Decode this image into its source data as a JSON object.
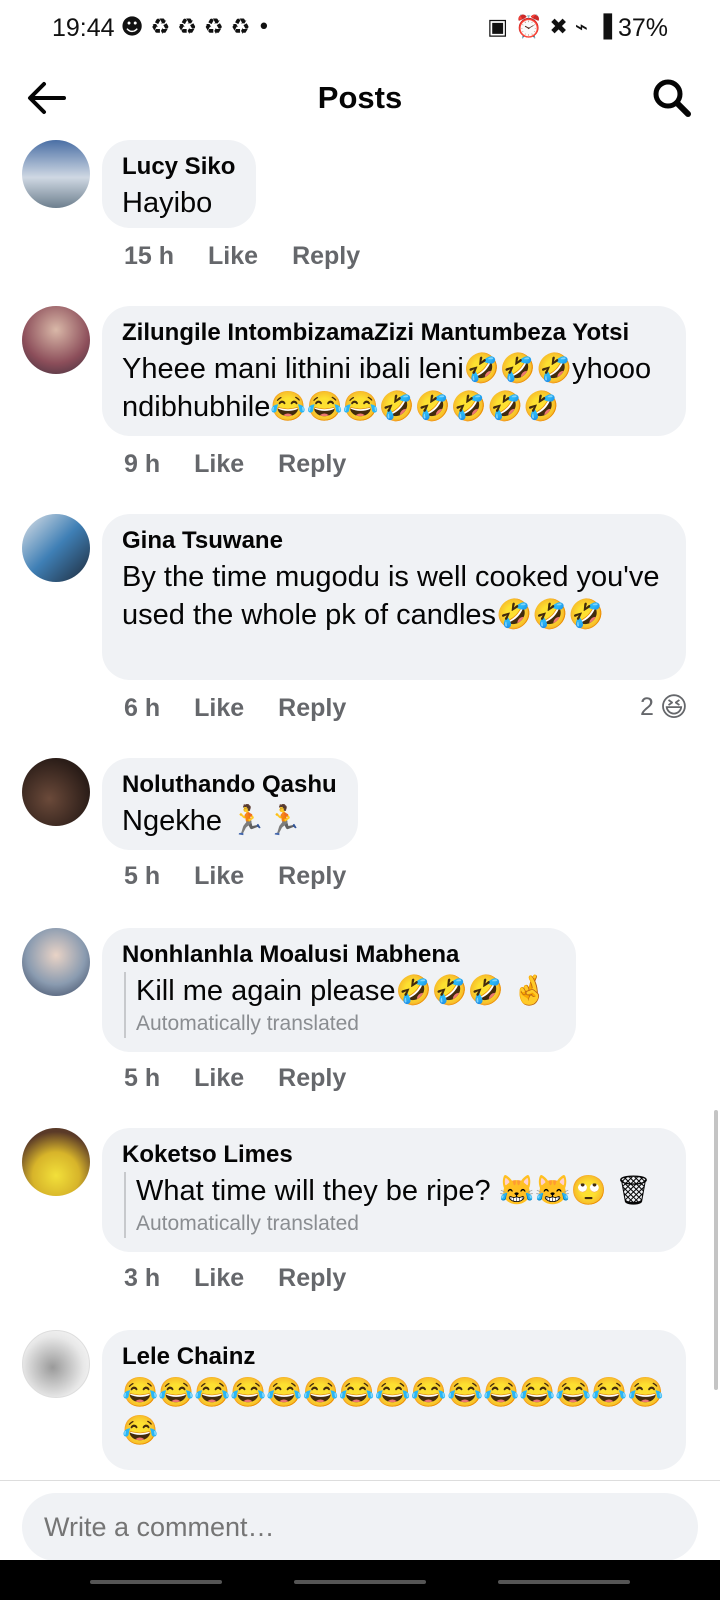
{
  "status_bar": {
    "time": "19:44",
    "left_icons": "☻ ♻ ♻ ♻ ♻ •",
    "right_icons": "▣ ⏰ ✖ ⌁ ▐",
    "battery": "37%"
  },
  "header": {
    "title": "Posts"
  },
  "comments": [
    {
      "author": "Lucy Siko",
      "text": "Hayibo",
      "time": "15 h",
      "like": "Like",
      "reply": "Reply"
    },
    {
      "author": "Zilungile IntombizamaZizi Mantumbeza Yotsi",
      "text": "Yheee mani lithini ibali leni🤣🤣🤣yhooo ndibhubhile😂😂😂🤣🤣🤣🤣🤣",
      "time": "9 h",
      "like": "Like",
      "reply": "Reply"
    },
    {
      "author": "Gina Tsuwane",
      "text": "By the time mugodu is well cooked you've used the whole pk of candles🤣🤣🤣",
      "time": "6 h",
      "like": "Like",
      "reply": "Reply",
      "reaction_count": "2",
      "reaction_icon": "😆"
    },
    {
      "author": "Noluthando Qashu",
      "text": "Ngekhe 🏃🏃",
      "time": "5 h",
      "like": "Like",
      "reply": "Reply"
    },
    {
      "author": "Nonhlanhla Moalusi Mabhena",
      "text": "Kill me again please🤣🤣🤣 🤞",
      "translated_note": "Automatically translated",
      "time": "5 h",
      "like": "Like",
      "reply": "Reply"
    },
    {
      "author": "Koketso Limes",
      "text": "What time will they be ripe? 😹😹🙄 🗑",
      "translated_note": "Automatically translated",
      "time": "3 h",
      "like": "Like",
      "reply": "Reply"
    },
    {
      "author": "Lele Chainz",
      "text": "😂😂😂😂😂😂😂😂😂😂😂😂😂😂😂😂"
    }
  ],
  "composer": {
    "placeholder": "Write a comment…"
  },
  "colors": {
    "bubble": "#f0f2f5",
    "meta": "#65676b",
    "text": "#050505"
  }
}
